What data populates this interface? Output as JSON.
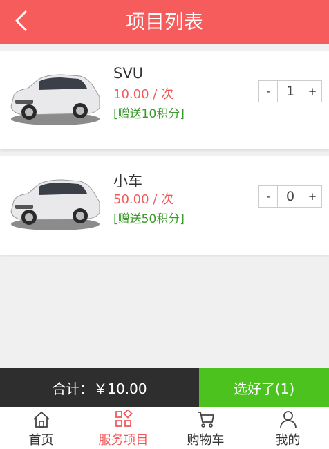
{
  "header": {
    "title": "项目列表",
    "back_icon": "chevron-left-icon"
  },
  "items": [
    {
      "name": "SVU",
      "price": "10.00 / 次",
      "bonus": "[赠送10积分]",
      "quantity": "1",
      "minus": "-",
      "plus": "+",
      "image": "white-suv-car"
    },
    {
      "name": "小车",
      "price": "50.00 / 次",
      "bonus": "[赠送50积分]",
      "quantity": "0",
      "minus": "-",
      "plus": "+",
      "image": "white-suv-car"
    }
  ],
  "checkout": {
    "total": "合计：￥10.00",
    "confirm": "选好了(1)"
  },
  "tabbar": [
    {
      "label": "首页",
      "icon": "home-icon",
      "active": false
    },
    {
      "label": "服务项目",
      "icon": "grid-icon",
      "active": true
    },
    {
      "label": "购物车",
      "icon": "cart-icon",
      "active": false
    },
    {
      "label": "我的",
      "icon": "user-icon",
      "active": false
    }
  ],
  "colors": {
    "header": "#f75c5c",
    "price": "#f05a5a",
    "bonus": "#3a9a2a",
    "total_bar": "#2e2e2e",
    "confirm": "#4cc21f",
    "tab_active": "#f05a5a"
  }
}
